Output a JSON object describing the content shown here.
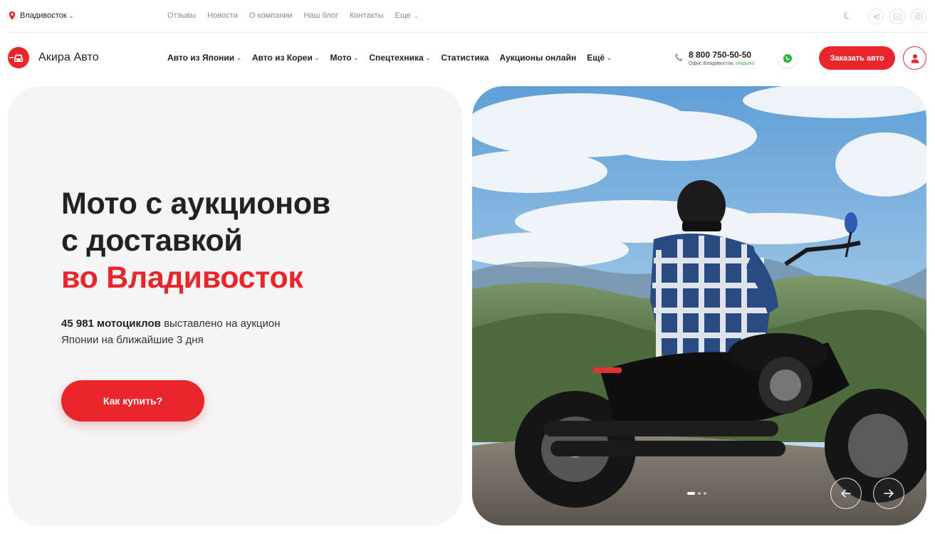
{
  "topbar": {
    "city": "Владивосток",
    "links": [
      "Отзывы",
      "Новости",
      "О компании",
      "Наш блог",
      "Контакты"
    ],
    "more": "Еще"
  },
  "header": {
    "logo_text": "Акира Авто",
    "nav": [
      {
        "label": "Авто из Японии",
        "dropdown": true
      },
      {
        "label": "Авто из Кореи",
        "dropdown": true
      },
      {
        "label": "Мото",
        "dropdown": true
      },
      {
        "label": "Спецтехника",
        "dropdown": true
      },
      {
        "label": "Статистика",
        "dropdown": false
      },
      {
        "label": "Аукционы онлайн",
        "dropdown": false
      },
      {
        "label": "Ещё",
        "dropdown": true
      }
    ],
    "phone": "8 800 750-50-50",
    "office_label": "Офис Владивосток,",
    "office_status": "открыто",
    "order_button": "Заказать авто"
  },
  "hero": {
    "title_line1": "Мото с аукционов",
    "title_line2": "с доставкой",
    "title_line3": "во Владивосток",
    "count": "45 981 мотоциклов",
    "desc_rest": " выставлено на аукцион",
    "desc_line2": "Японии на ближайшие 3 дня",
    "button": "Как купить?"
  },
  "slider": {
    "slides": 3,
    "active": 1,
    "prev_icon": "arrow-left-icon",
    "next_icon": "arrow-right-icon"
  },
  "colors": {
    "accent": "#e8262b",
    "open_status": "#2fb344",
    "panel_bg": "#f5f5f5"
  }
}
